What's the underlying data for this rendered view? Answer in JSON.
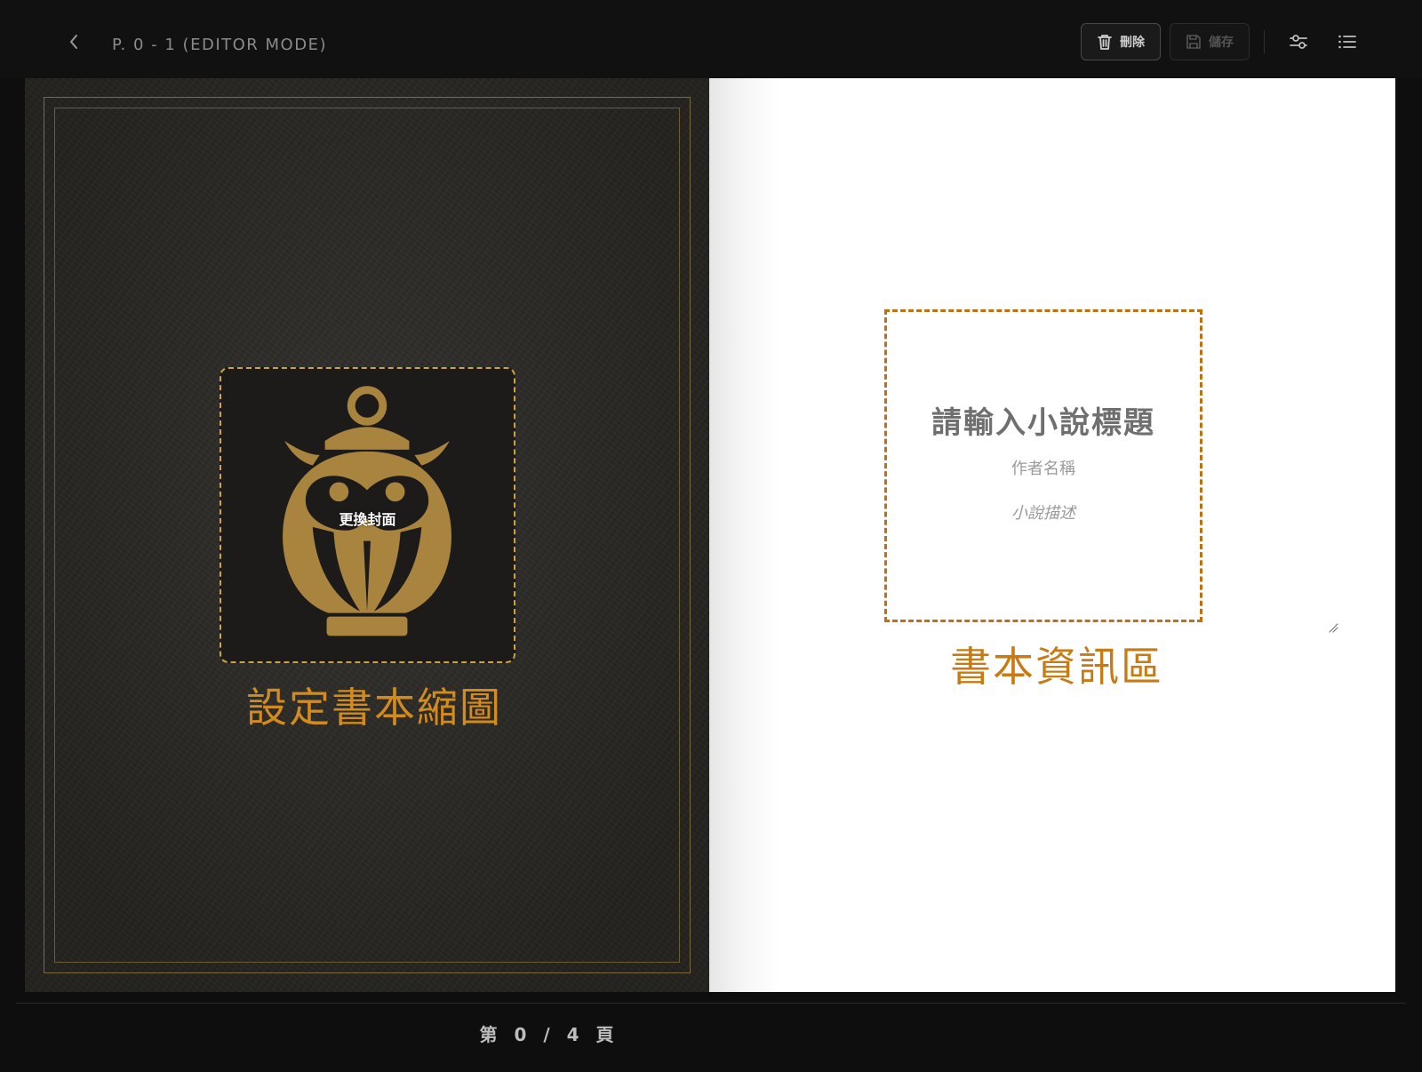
{
  "header": {
    "page_label": "P. 0 - 1 (EDITOR MODE)",
    "delete_label": "刪除",
    "save_label": "儲存"
  },
  "cover": {
    "change_cover_label": "更換封面",
    "annotation": "設定書本縮圖"
  },
  "info_page": {
    "title_placeholder": "請輸入小說標題",
    "author_placeholder": "作者名稱",
    "description_placeholder": "小說描述",
    "annotation": "書本資訊區"
  },
  "footer": {
    "page_counter": "第 0 / 4 頁"
  },
  "colors": {
    "background": "#0e0e0e",
    "cover": "#2b2a26",
    "gold": "#a8843e",
    "annotation": "#d48b1d",
    "info_box_border": "#c07010"
  },
  "icons": {
    "back": "chevron-left-icon",
    "delete": "trash-icon",
    "save": "floppy-disk-icon",
    "settings": "sliders-icon",
    "list": "list-icon"
  }
}
